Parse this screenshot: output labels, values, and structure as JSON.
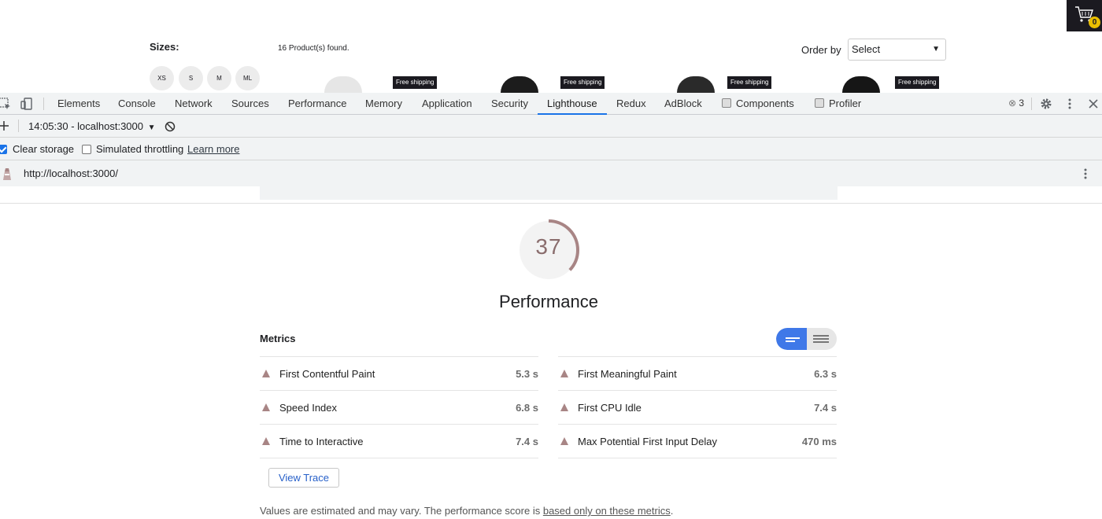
{
  "store": {
    "cart_count": "0",
    "sizes_title": "Sizes:",
    "sizes": [
      "XS",
      "S",
      "M",
      "ML"
    ],
    "products_found": "16 Product(s) found.",
    "order_by_label": "Order by",
    "order_by_value": "Select",
    "badges": [
      "Free shipping",
      "Free shipping",
      "Free shipping",
      "Free shipping"
    ]
  },
  "devtools": {
    "tabs": [
      "Elements",
      "Console",
      "Network",
      "Sources",
      "Performance",
      "Memory",
      "Application",
      "Security",
      "Lighthouse",
      "Redux",
      "AdBlock",
      "Components",
      "Profiler"
    ],
    "active_tab": "Lighthouse",
    "error_count": "3",
    "report_selector": "14:05:30 - localhost:3000",
    "clear_storage_label": "Clear storage",
    "clear_storage_checked": true,
    "simulated_throttling_label": "Simulated throttling",
    "simulated_throttling_checked": false,
    "learn_more": "Learn more",
    "url": "http://localhost:3000/"
  },
  "report": {
    "score": "37",
    "score_fraction": 0.37,
    "category": "Performance",
    "metrics_title": "Metrics",
    "metrics_left": [
      {
        "label": "First Contentful Paint",
        "value": "5.3 s"
      },
      {
        "label": "Speed Index",
        "value": "6.8 s"
      },
      {
        "label": "Time to Interactive",
        "value": "7.4 s"
      }
    ],
    "metrics_right": [
      {
        "label": "First Meaningful Paint",
        "value": "6.3 s"
      },
      {
        "label": "First CPU Idle",
        "value": "7.4 s"
      },
      {
        "label": "Max Potential First Input Delay",
        "value": "470 ms"
      }
    ],
    "view_trace": "View Trace",
    "note_prefix": "Values are estimated and may vary. The performance score is ",
    "note_link": "based only on these metrics",
    "note_suffix": "."
  },
  "colors": {
    "accent": "#1a73e8",
    "score_arc": "#a88585",
    "toggle_on": "#3f78e8"
  }
}
